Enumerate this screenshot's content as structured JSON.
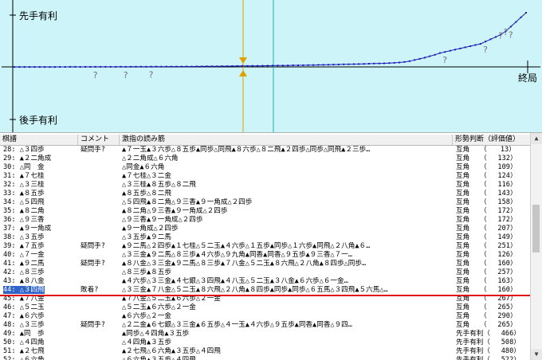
{
  "graph": {
    "top_label": "先手有利",
    "bottom_label": "後手有利",
    "end_label": "終局",
    "question_mark": "?",
    "colors": {
      "background": "#cdf4f8",
      "line": "#1a1ab4",
      "zero_line": "#000000",
      "cursor": "#e0a000",
      "cursor2": "#20b0b0",
      "bad": "#c00000"
    },
    "eval_series": [
      -1,
      -1,
      -2,
      -2,
      -1,
      -1,
      -2,
      -1,
      -1,
      0,
      0,
      1,
      1,
      0,
      1,
      1,
      2,
      1,
      1,
      2,
      2,
      3,
      2,
      3,
      3,
      4,
      3,
      4,
      5,
      4,
      5,
      6,
      5,
      6,
      7,
      6,
      8,
      8,
      9,
      10,
      10,
      12,
      12,
      14,
      15,
      16,
      16,
      18,
      18,
      20,
      21,
      22,
      23,
      24,
      25,
      27,
      28,
      29,
      30,
      32,
      34,
      36,
      38,
      40,
      42,
      44,
      46,
      48,
      50,
      52,
      55,
      58,
      60,
      62,
      66,
      70,
      76,
      86,
      100,
      120,
      140,
      160,
      185,
      210,
      240,
      260,
      280,
      300,
      320,
      340,
      360,
      380,
      400,
      440,
      480,
      520,
      560,
      620,
      700,
      780,
      860,
      940
    ],
    "question_marks_at": [
      16,
      22,
      27,
      85,
      93,
      98
    ]
  },
  "columns": {
    "move": "棋譜",
    "comment": "コメント",
    "line": "激指の読み筋",
    "eval": "形勢判断（評価値）"
  },
  "rows": [
    {
      "move": "28: △３四歩",
      "comment": "疑問手?",
      "line": "▲７一玉▲３六歩△８五歩▲同歩△同飛▲８六歩△８二飛▲２四歩△同歩△同飛▲２三歩…",
      "eval": "互角　　（　　13）"
    },
    {
      "move": "29: ▲２二角成",
      "comment": "",
      "line": "△２二角成△６六角",
      "eval": "互角　　（　 132）"
    },
    {
      "move": "30: △同　金",
      "comment": "",
      "line": "△同金▲６六角",
      "eval": "互角　　（　 109）"
    },
    {
      "move": "31: ▲７七桂",
      "comment": "",
      "line": "▲７七桂△３二金",
      "eval": "互角　　（　 124）"
    },
    {
      "move": "32: △３三桂",
      "comment": "",
      "line": "△３三桂▲８五歩△８二飛",
      "eval": "互角　　（　 116）"
    },
    {
      "move": "33: ▲８五歩",
      "comment": "",
      "line": "▲８五歩△８二飛",
      "eval": "互角　　（　 143）"
    },
    {
      "move": "34: △５四飛",
      "comment": "",
      "line": "△５四飛▲８二角△９三香▲９一角成△２四歩",
      "eval": "互角　　（　 158）"
    },
    {
      "move": "35: ▲８二角",
      "comment": "",
      "line": "▲８二角△９三香▲９一角成△２四歩",
      "eval": "互角　　（　 172）"
    },
    {
      "move": "36: △９三香",
      "comment": "",
      "line": "△９三香▲９一角成△２四歩",
      "eval": "互角　　（　 172）"
    },
    {
      "move": "37: ▲９一角成",
      "comment": "",
      "line": "▲９一角成△２四歩",
      "eval": "互角　　（　 207）"
    },
    {
      "move": "38: △３五歩",
      "comment": "",
      "line": "△３五歩▲９二馬",
      "eval": "互角　　（　 149）"
    },
    {
      "move": "39: ▲７五歩",
      "comment": "疑問手?",
      "line": "▲９二馬△２四歩▲１七桂△５二玉▲４六歩△１五歩▲同歩△１六歩▲同飛△２八角▲６…",
      "eval": "互角　　（　 251）"
    },
    {
      "move": "40: △７一金",
      "comment": "",
      "line": "△３三金▲９二馬△８三歩▲４六歩△９九角▲同香▲同香△９五歩▲９三香△７一…",
      "eval": "互角　　（　 126）"
    },
    {
      "move": "41: ▲９二馬",
      "comment": "疑問手?",
      "line": "▲８八金△３三金▲９二馬△８三歩▲７八金△５二玉▲８六飛△２八角▲８四歩△同歩…",
      "eval": "互角　　（　 160）"
    },
    {
      "move": "42: △８三歩",
      "comment": "",
      "line": "△８三歩▲８五歩",
      "eval": "互角　　（　 257）"
    },
    {
      "move": "43: ▲８八金",
      "comment": "",
      "line": "▲４六歩△３三金▲４七銀△３四飛▲４八玉△５二玉▲３八金▲６六歩△６一金…",
      "eval": "互角　　（　 163）"
    },
    {
      "move": "44: △３四飛",
      "comment": "敗着?",
      "line": "△３三金▲７八金△５二玉▲８六飛△２八角▲８四歩▲同歩▲同歩△６五馬△３四飛▲５六馬△…",
      "eval": "互角　　（　 160）"
    },
    {
      "move": "45: ▲７八金",
      "comment": "",
      "line": "▲７八金△５二玉▲６六歩△２一金",
      "eval": "互角　　（　 267）"
    },
    {
      "move": "46: △５二玉",
      "comment": "",
      "line": "△５二玉▲６六歩△２一金",
      "eval": "互角　　（　 265）"
    },
    {
      "move": "47: ▲６六歩",
      "comment": "",
      "line": "▲６六歩△２一金",
      "eval": "互角　　（　 290）"
    },
    {
      "move": "48: △３三歩",
      "comment": "疑問手?",
      "line": "△２二金▲６七銀△３三金▲６五歩△４一玉▲４六歩△９五歩▲同香▲同香△９四…",
      "eval": "互角　　（　 265）"
    },
    {
      "move": "49: ▲同　歩",
      "comment": "",
      "line": "▲同歩△４四角▲３五歩",
      "eval": "先手有利（　 466）"
    },
    {
      "move": "50: △４四角",
      "comment": "",
      "line": "△４四角▲３五歩",
      "eval": "先手有利（　 508）"
    },
    {
      "move": "51: ▲２七飛",
      "comment": "",
      "line": "▲２七飛△６六角▲３五歩△４四飛",
      "eval": "先手有利（　 480）"
    },
    {
      "move": "52: △６六角",
      "comment": "",
      "line": "△６六角▲３五歩△４四飛",
      "eval": "先手有利（　 522）"
    }
  ],
  "selected_row": 16,
  "scroll": {
    "up": "▲",
    "down": "▼"
  }
}
